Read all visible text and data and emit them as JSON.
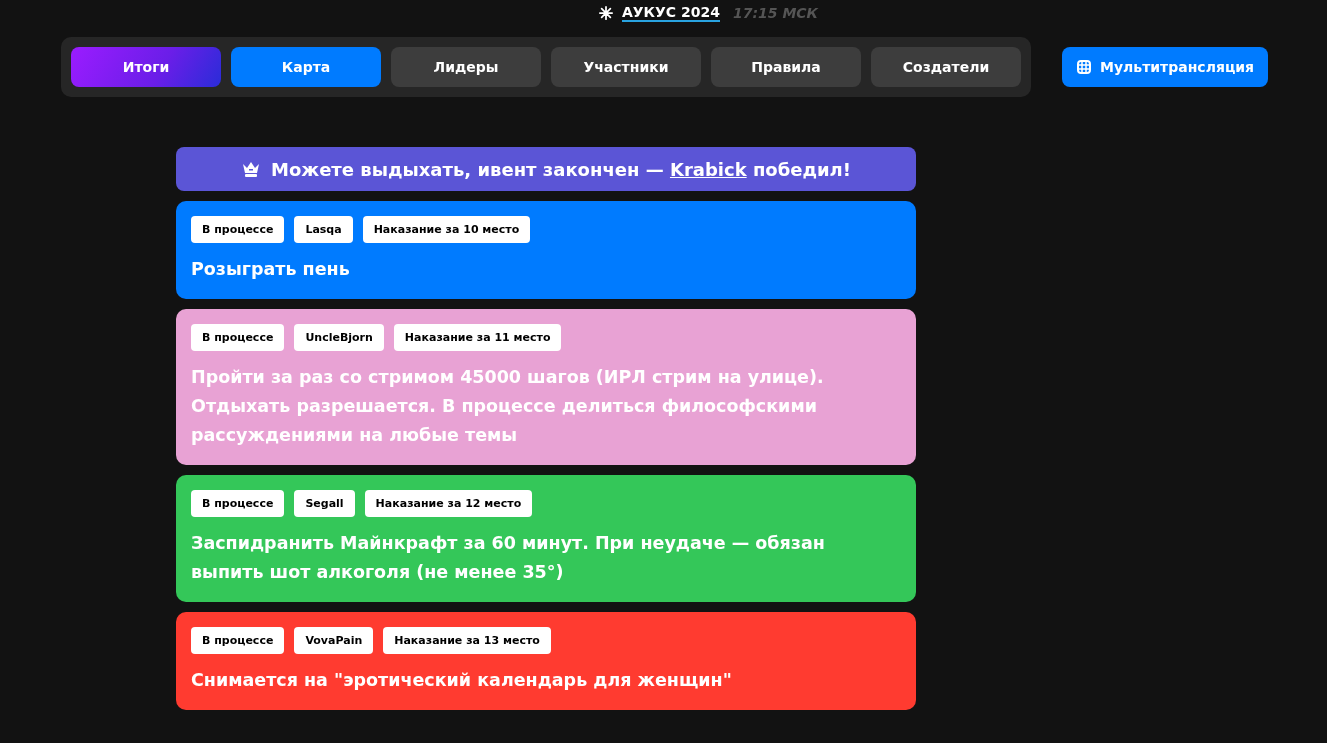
{
  "header": {
    "title": "АУКУС 2024",
    "time": "17:15 МСК"
  },
  "tabs": [
    {
      "label": "Итоги",
      "kind": "gradient",
      "selected": false
    },
    {
      "label": "Карта",
      "kind": "plain",
      "selected": true
    },
    {
      "label": "Лидеры",
      "kind": "plain",
      "selected": false
    },
    {
      "label": "Участники",
      "kind": "plain",
      "selected": false
    },
    {
      "label": "Правила",
      "kind": "plain",
      "selected": false
    },
    {
      "label": "Создатели",
      "kind": "plain",
      "selected": false
    }
  ],
  "multistream_button": "Мультитрансляция",
  "banner": {
    "before": "Можете выдыхать, ивент закончен — ",
    "winner": "Krabick",
    "after": " победил!"
  },
  "cards": [
    {
      "color": "#007bff",
      "tags": [
        "В процессе",
        "Lasqa",
        "Наказание за 10 место"
      ],
      "text": "Розыграть пень"
    },
    {
      "color": "#e8a2d4",
      "tags": [
        "В процессе",
        "UncleBjorn",
        "Наказание за 11 место"
      ],
      "text": "Пройти за раз со стримом 45000 шагов (ИРЛ стрим на улице). Отдыхать разрешается. В процессе делиться философскими рассуждениями на любые темы"
    },
    {
      "color": "#34c759",
      "tags": [
        "В процессе",
        "Segall",
        "Наказание за 12 место"
      ],
      "text": "Заспидранить Майнкрафт за 60 минут. При неудаче — обязан выпить шот алкоголя (не менее 35°)"
    },
    {
      "color": "#ff3b30",
      "tags": [
        "В процессе",
        "VovaPain",
        "Наказание за 13 место"
      ],
      "text": "Снимается на \"эротический календарь для женщин\""
    }
  ]
}
